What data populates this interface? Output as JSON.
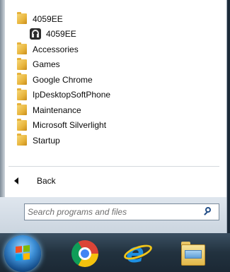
{
  "start_menu": {
    "programs": [
      {
        "label": "4059EE",
        "icon": "folder-icon",
        "indent": false
      },
      {
        "label": "4059EE",
        "icon": "headset-icon",
        "indent": true
      },
      {
        "label": "Accessories",
        "icon": "folder-icon",
        "indent": false
      },
      {
        "label": "Games",
        "icon": "folder-icon",
        "indent": false
      },
      {
        "label": "Google Chrome",
        "icon": "folder-icon",
        "indent": false
      },
      {
        "label": "IpDesktopSoftPhone",
        "icon": "folder-icon",
        "indent": false
      },
      {
        "label": "Maintenance",
        "icon": "folder-icon",
        "indent": false
      },
      {
        "label": "Microsoft Silverlight",
        "icon": "folder-icon",
        "indent": false
      },
      {
        "label": "Startup",
        "icon": "folder-icon",
        "indent": false
      }
    ],
    "back_label": "Back",
    "search": {
      "placeholder": "Search programs and files",
      "value": ""
    }
  },
  "taskbar": {
    "icons": [
      "start-orb-icon",
      "chrome-icon",
      "internet-explorer-icon",
      "windows-explorer-icon"
    ]
  },
  "colors": {
    "taskbar": "#22323f",
    "menu_bg": "#ffffff",
    "search_area": "#d6dee7"
  }
}
